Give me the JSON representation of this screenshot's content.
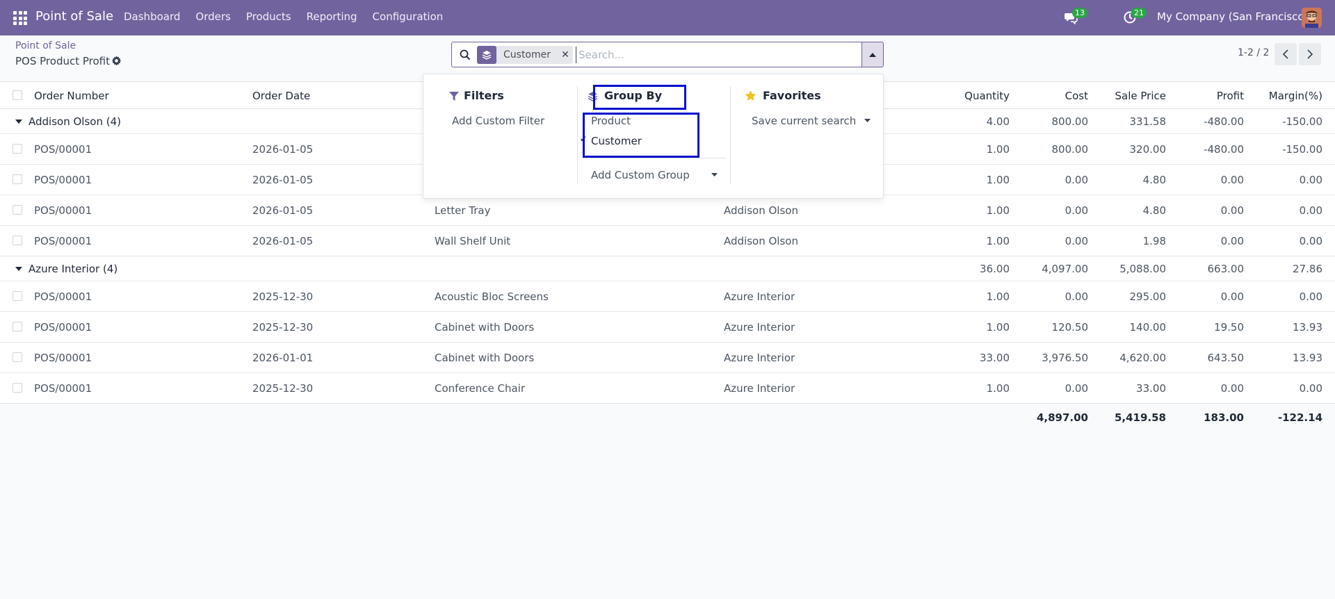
{
  "navbar": {
    "brand": "Point of Sale",
    "menu": [
      "Dashboard",
      "Orders",
      "Products",
      "Reporting",
      "Configuration"
    ],
    "messages_count": "13",
    "activities_count": "21",
    "company": "My Company (San Francisco)",
    "color": "#71639e"
  },
  "breadcrumb": {
    "parent": "Point of Sale",
    "current": "POS Product Profit"
  },
  "search": {
    "facet_label": "Customer",
    "placeholder": "Search..."
  },
  "pager": {
    "value": "1-2 / 2"
  },
  "table": {
    "columns": [
      "Order Number",
      "Order Date",
      "Quantity",
      "Cost",
      "Sale Price",
      "Profit",
      "Margin(%)"
    ],
    "groups": [
      {
        "label": "Addison Olson (4)",
        "totals": [
          "4.00",
          "800.00",
          "331.58",
          "-480.00",
          "-150.00"
        ],
        "rows": [
          {
            "order": "POS/00001",
            "date": "2026-01-05",
            "product": "",
            "customer": "",
            "qty": "1.00",
            "cost": "800.00",
            "price": "320.00",
            "profit": "-480.00",
            "margin": "-150.00"
          },
          {
            "order": "POS/00001",
            "date": "2026-01-05",
            "product": "",
            "customer": "",
            "qty": "1.00",
            "cost": "0.00",
            "price": "4.80",
            "profit": "0.00",
            "margin": "0.00"
          },
          {
            "order": "POS/00001",
            "date": "2026-01-05",
            "product": "Letter Tray",
            "customer": "Addison Olson",
            "qty": "1.00",
            "cost": "0.00",
            "price": "4.80",
            "profit": "0.00",
            "margin": "0.00"
          },
          {
            "order": "POS/00001",
            "date": "2026-01-05",
            "product": "Wall Shelf Unit",
            "customer": "Addison Olson",
            "qty": "1.00",
            "cost": "0.00",
            "price": "1.98",
            "profit": "0.00",
            "margin": "0.00"
          }
        ]
      },
      {
        "label": "Azure Interior (4)",
        "totals": [
          "36.00",
          "4,097.00",
          "5,088.00",
          "663.00",
          "27.86"
        ],
        "rows": [
          {
            "order": "POS/00001",
            "date": "2025-12-30",
            "product": "Acoustic Bloc Screens",
            "customer": "Azure Interior",
            "qty": "1.00",
            "cost": "0.00",
            "price": "295.00",
            "profit": "0.00",
            "margin": "0.00"
          },
          {
            "order": "POS/00001",
            "date": "2025-12-30",
            "product": "Cabinet with Doors",
            "customer": "Azure Interior",
            "qty": "1.00",
            "cost": "120.50",
            "price": "140.00",
            "profit": "19.50",
            "margin": "13.93"
          },
          {
            "order": "POS/00001",
            "date": "2026-01-01",
            "product": "Cabinet with Doors",
            "customer": "Azure Interior",
            "qty": "33.00",
            "cost": "3,976.50",
            "price": "4,620.00",
            "profit": "643.50",
            "margin": "13.93"
          },
          {
            "order": "POS/00001",
            "date": "2025-12-30",
            "product": "Conference Chair",
            "customer": "Azure Interior",
            "qty": "1.00",
            "cost": "0.00",
            "price": "33.00",
            "profit": "0.00",
            "margin": "0.00"
          }
        ]
      }
    ],
    "grand_totals": [
      "4,897.00",
      "5,419.58",
      "183.00",
      "-122.14"
    ]
  },
  "dropdown": {
    "filters_title": "Filters",
    "add_custom_filter": "Add Custom Filter",
    "groupby_title": "Group By",
    "groupby_options": [
      "Product",
      "Customer"
    ],
    "groupby_selected": "Customer",
    "add_custom_group": "Add Custom Group",
    "favorites_title": "Favorites",
    "save_search": "Save current search"
  }
}
